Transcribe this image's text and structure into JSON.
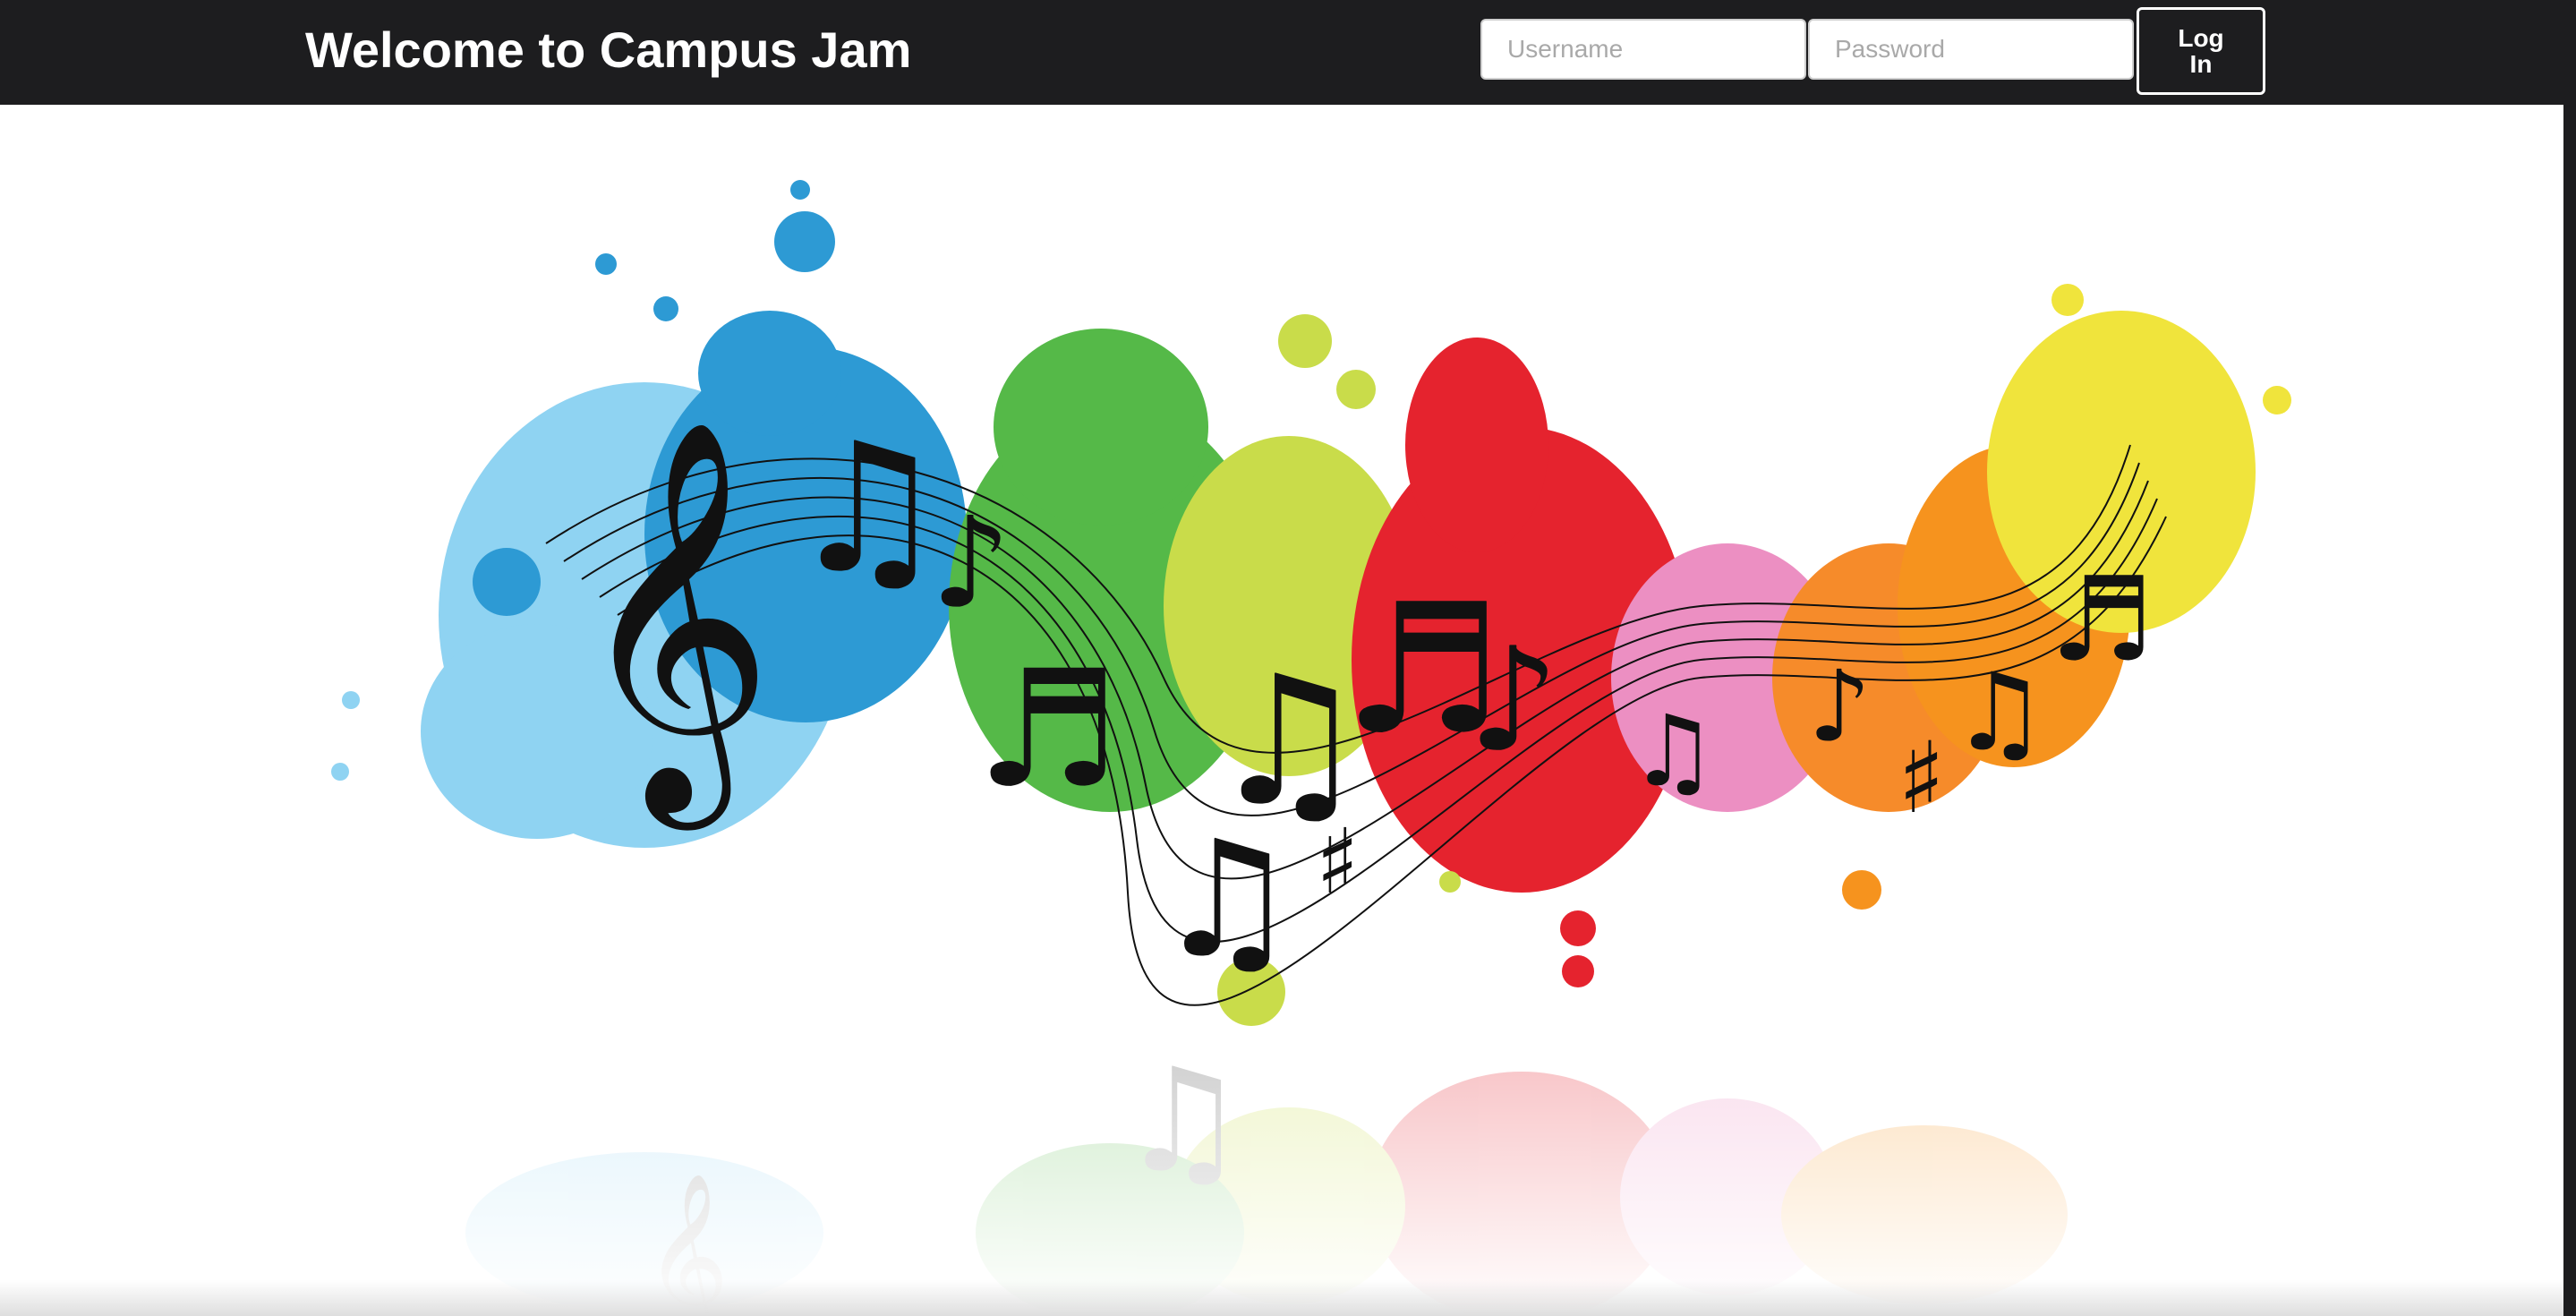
{
  "header": {
    "title": "Welcome to Campus Jam",
    "username_placeholder": "Username",
    "password_placeholder": "Password",
    "login_label": "Log In"
  },
  "hero": {
    "image": "music-notes-paint-splash-illustration",
    "colors": {
      "sky": "#8fd3f2",
      "blue": "#2d9ad4",
      "green": "#55b948",
      "lime": "#c9dc4a",
      "red": "#e5232e",
      "pink": "#ec8fc2",
      "orange": "#f6931e",
      "yellow": "#f0e43c"
    }
  },
  "theme": {
    "navbar_bg": "#1d1d1f",
    "navbar_text": "#ffffff"
  }
}
